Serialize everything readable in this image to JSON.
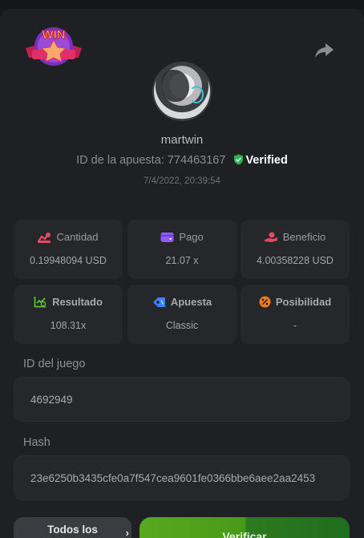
{
  "header": {
    "badge_text": "WIN",
    "share_icon": "share-icon"
  },
  "profile": {
    "username": "martwin",
    "bet_id_label": "ID de la apuesta:",
    "bet_id": "774463167",
    "verified_label": "Verified",
    "timestamp": "7/4/2022, 20:39:54"
  },
  "stats": [
    {
      "label": "Cantidad",
      "value": "0.19948094 USD",
      "icon": "coins-icon",
      "color": "#e8485f"
    },
    {
      "label": "Pago",
      "value": "21.07 x",
      "icon": "wallet-icon",
      "color": "#8b5cf6"
    },
    {
      "label": "Beneficio",
      "value": "4.00358228 USD",
      "icon": "hand-coin-icon",
      "color": "#e8485f"
    },
    {
      "label": "Resultado",
      "value": "108.31x",
      "icon": "chart-check-icon",
      "color": "#5cc13c"
    },
    {
      "label": "Apuesta",
      "value": "Classic",
      "icon": "tag-icon",
      "color": "#3b82f6"
    },
    {
      "label": "Posibilidad",
      "value": "-",
      "icon": "percent-icon",
      "color": "#f07a1a"
    }
  ],
  "game_id": {
    "label": "ID del juego",
    "value": "4692949"
  },
  "hash": {
    "label": "Hash",
    "value": "23e6250b3435cfe0a7f547cea9601fe0366bbe6aee2aa2453"
  },
  "buttons": {
    "all_label": "Todos los",
    "verify_label": "Verificar"
  }
}
